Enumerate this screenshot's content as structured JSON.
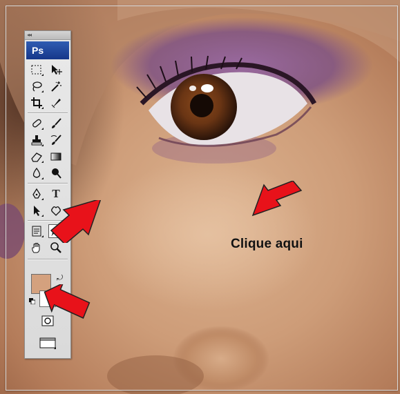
{
  "toolbar": {
    "badge_label": "Ps",
    "type_tool_glyph": "T",
    "tools": [
      "marquee-icon",
      "move-icon",
      "lasso-icon",
      "magic-wand-icon",
      "crop-icon",
      "slice-icon",
      "healing-brush-icon",
      "brush-icon",
      "clone-stamp-icon",
      "history-brush-icon",
      "eraser-icon",
      "gradient-icon",
      "blur-icon",
      "dodge-icon",
      "pen-icon",
      "type-icon",
      "path-selection-icon",
      "custom-shape-icon",
      "notes-icon",
      "eyedropper-icon",
      "hand-icon",
      "zoom-icon",
      "quick-mask-icon",
      "screen-mode-icon"
    ],
    "selected_tool": "eyedropper-icon"
  },
  "colors": {
    "foreground": "#d4a17e",
    "background": "#ffffff",
    "arrow_red": "#e8121a"
  },
  "annotation": {
    "caption": "Clique aqui"
  }
}
